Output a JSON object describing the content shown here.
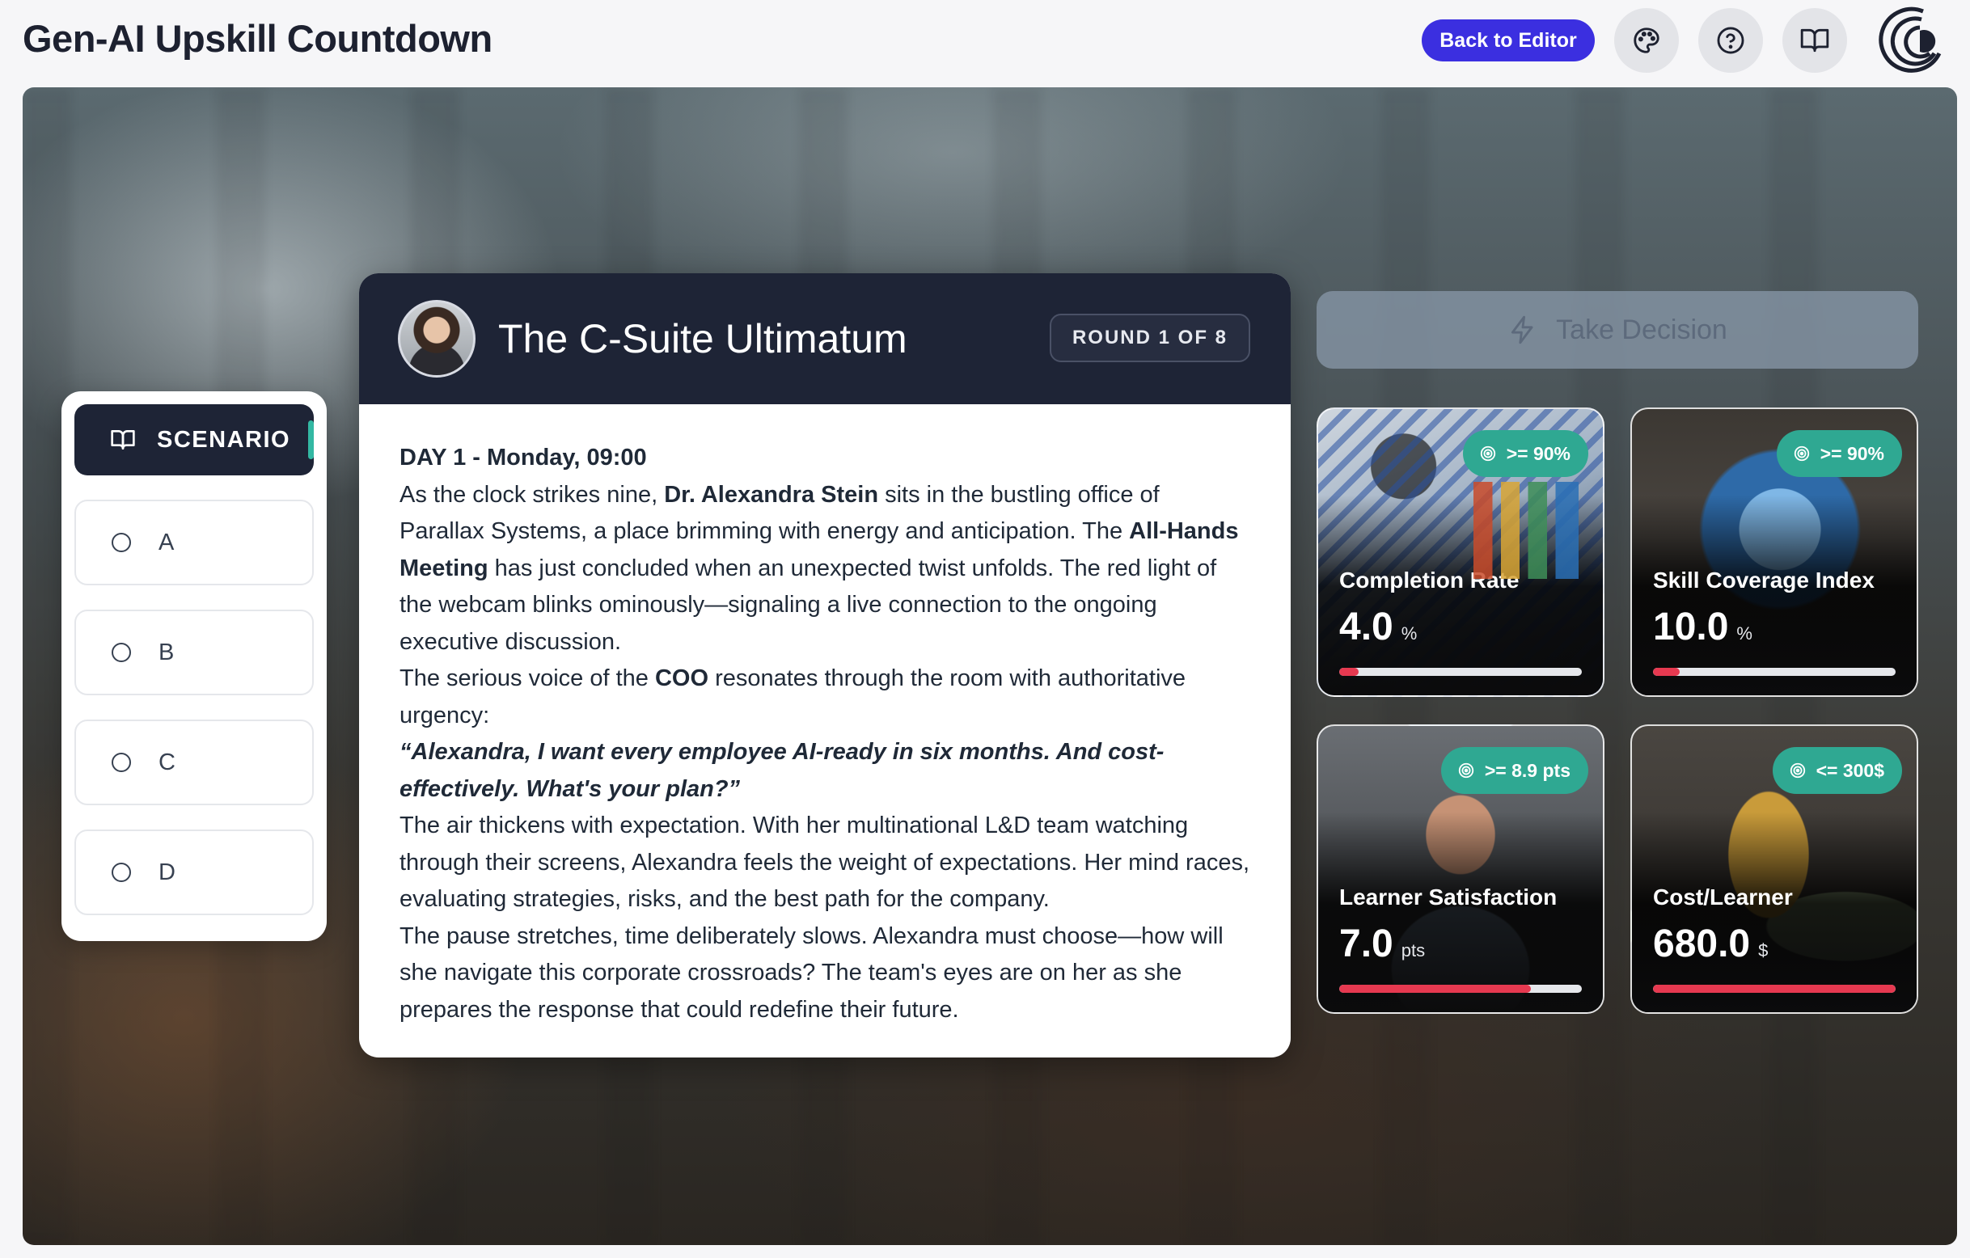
{
  "header": {
    "title": "Gen-AI Upskill Countdown",
    "back_label": "Back to Editor",
    "icons": [
      "palette-icon",
      "help-icon",
      "book-icon"
    ],
    "logo": "app-logo"
  },
  "choices": {
    "scenario_label": "SCENARIO",
    "options": [
      "A",
      "B",
      "C",
      "D"
    ]
  },
  "scenario": {
    "title": "The C-Suite Ultimatum",
    "round": "ROUND 1 OF 8",
    "day": "DAY 1 - Monday, 09:00",
    "p1_a": "As the clock strikes nine, ",
    "p1_b": "Dr. Alexandra Stein",
    "p1_c": " sits in the bustling office of Parallax Systems, a place brimming with energy and anticipation. The ",
    "p1_d": "All-Hands Meeting",
    "p1_e": " has just concluded when an unexpected twist unfolds. The red light of the webcam blinks ominously—signaling a live connection to the ongoing executive discussion.",
    "p2_a": "The serious voice of the ",
    "p2_b": "COO",
    "p2_c": " resonates through the room with authoritative urgency:",
    "quote": "“Alexandra, I want every employee AI-ready in six months. And cost-effectively. What's your plan?”",
    "p3": "The air thickens with expectation. With her multinational L&D team watching through their screens, Alexandra feels the weight of expectations. Her mind races, evaluating strategies, risks, and the best path for the company.",
    "p4": "The pause stretches, time deliberately slows. Alexandra must choose—how will she navigate this corporate crossroads? The team's eyes are on her as she prepares the response that could redefine their future."
  },
  "decision": {
    "label": "Take Decision"
  },
  "kpis": [
    {
      "label": "Completion Rate",
      "value": "4.0",
      "unit": "%",
      "target": ">= 90%",
      "progress": 0.08
    },
    {
      "label": "Skill Coverage Index",
      "value": "10.0",
      "unit": "%",
      "target": ">= 90%",
      "progress": 0.11
    },
    {
      "label": "Learner Satisfaction",
      "value": "7.0",
      "unit": "pts",
      "target": ">= 8.9 pts",
      "progress": 0.79
    },
    {
      "label": "Cost/Learner",
      "value": "680.0",
      "unit": "$",
      "target": "<= 300$",
      "progress": 1.0
    }
  ],
  "colors": {
    "accent": "#3b2fe0",
    "navy": "#1e2436",
    "teal": "#2fa892",
    "danger": "#e63950"
  }
}
